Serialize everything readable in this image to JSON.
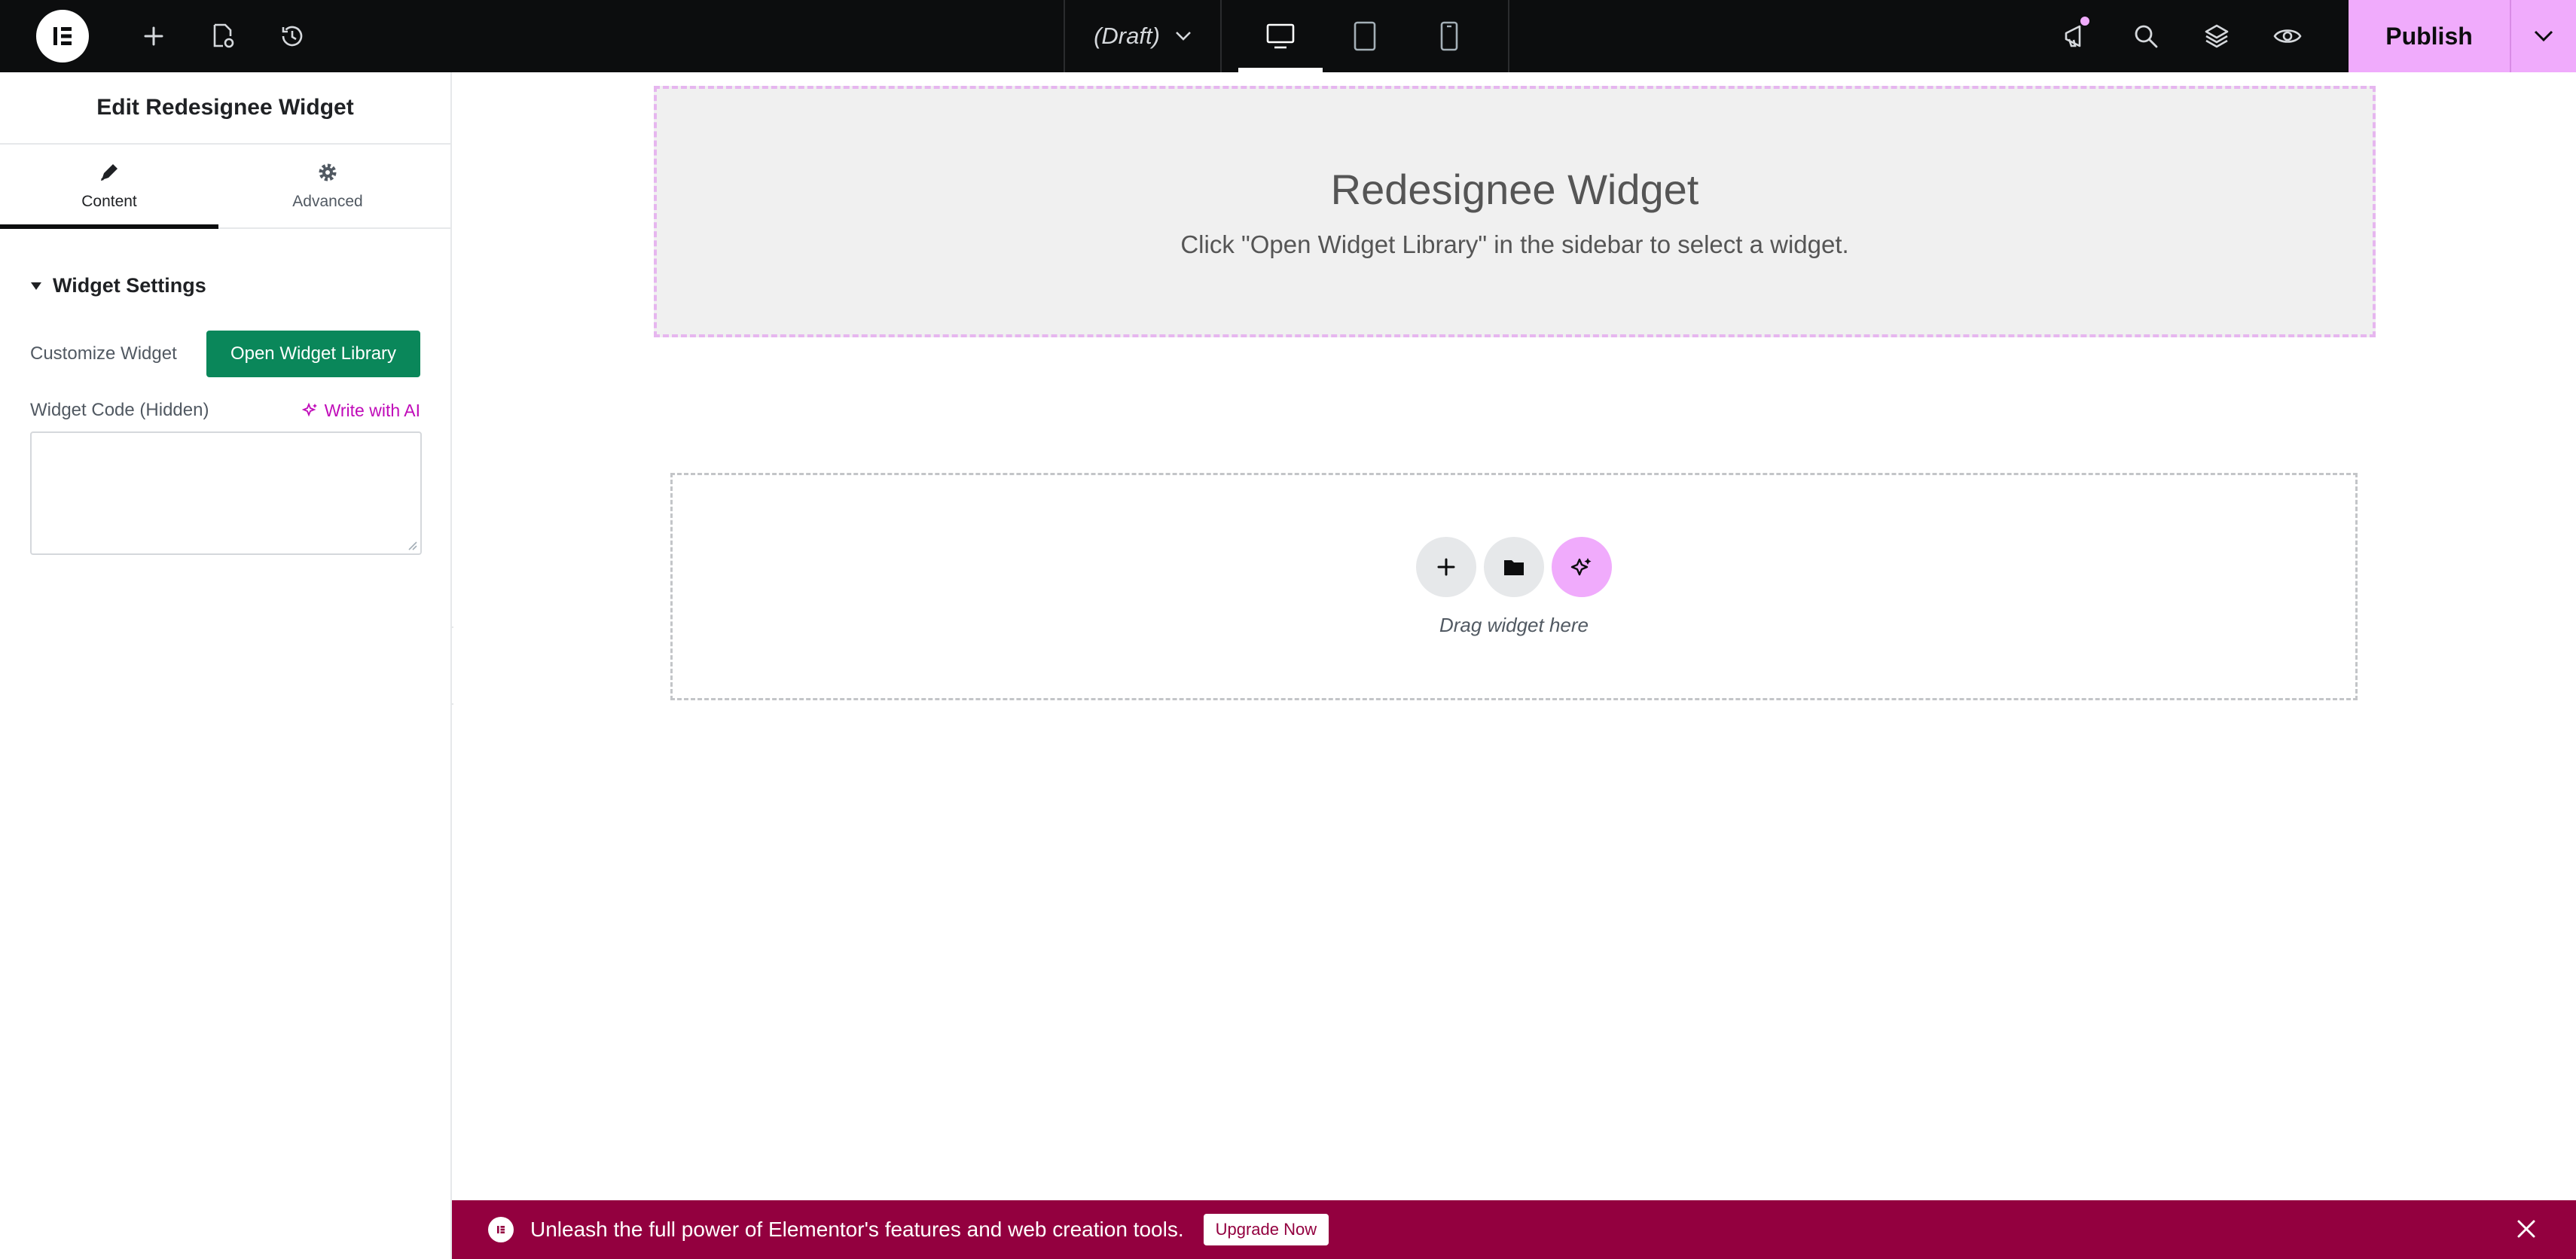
{
  "topbar": {
    "doc_status": "(Draft)",
    "publish_label": "Publish"
  },
  "panel": {
    "title": "Edit Redesignee Widget",
    "tabs": [
      {
        "label": "Content",
        "icon": "pencil-icon",
        "active": true
      },
      {
        "label": "Advanced",
        "icon": "gear-icon",
        "active": false
      }
    ],
    "section_title": "Widget Settings",
    "customize_label": "Customize Widget",
    "open_library_label": "Open Widget Library",
    "code_label": "Widget Code (Hidden)",
    "ai_label": "Write with AI",
    "code_value": ""
  },
  "canvas": {
    "widget_title": "Redesignee Widget",
    "widget_subtitle": "Click \"Open Widget Library\" in the sidebar to select a widget.",
    "drop_text": "Drag widget here"
  },
  "promo": {
    "text": "Unleash the full power of Elementor's features and web creation tools.",
    "button_label": "Upgrade Now"
  },
  "colors": {
    "topbar_bg": "#0c0d0e",
    "accent_pink": "#f0abfc",
    "primary_green": "#0a875a",
    "promo_bg": "#93003f",
    "ai_magenta": "#c00bb9"
  }
}
